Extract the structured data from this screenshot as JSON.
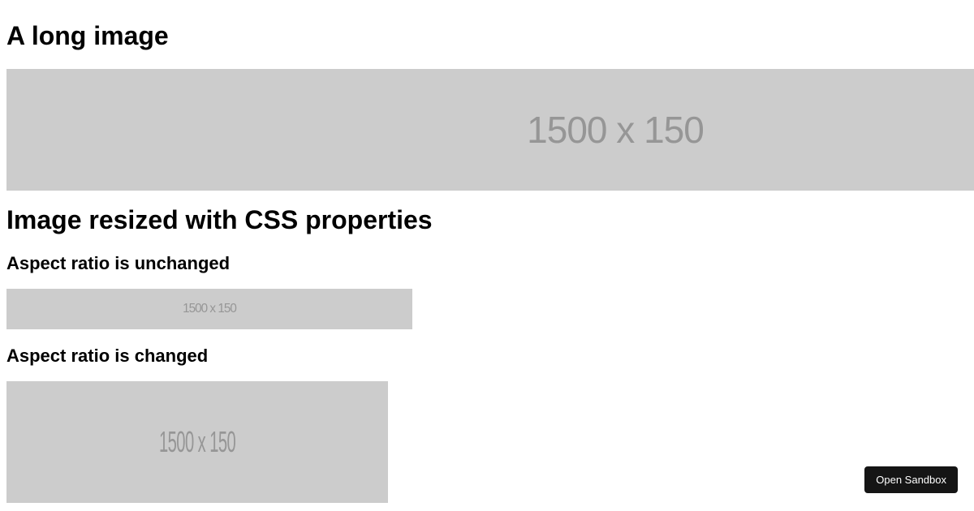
{
  "headings": {
    "h1_long": "A long image",
    "h1_resized": "Image resized with CSS properties",
    "h2_unchanged": "Aspect ratio is unchanged",
    "h2_changed": "Aspect ratio is changed"
  },
  "placeholder": {
    "text": "1500 x 150"
  },
  "button": {
    "open_sandbox": "Open Sandbox"
  }
}
